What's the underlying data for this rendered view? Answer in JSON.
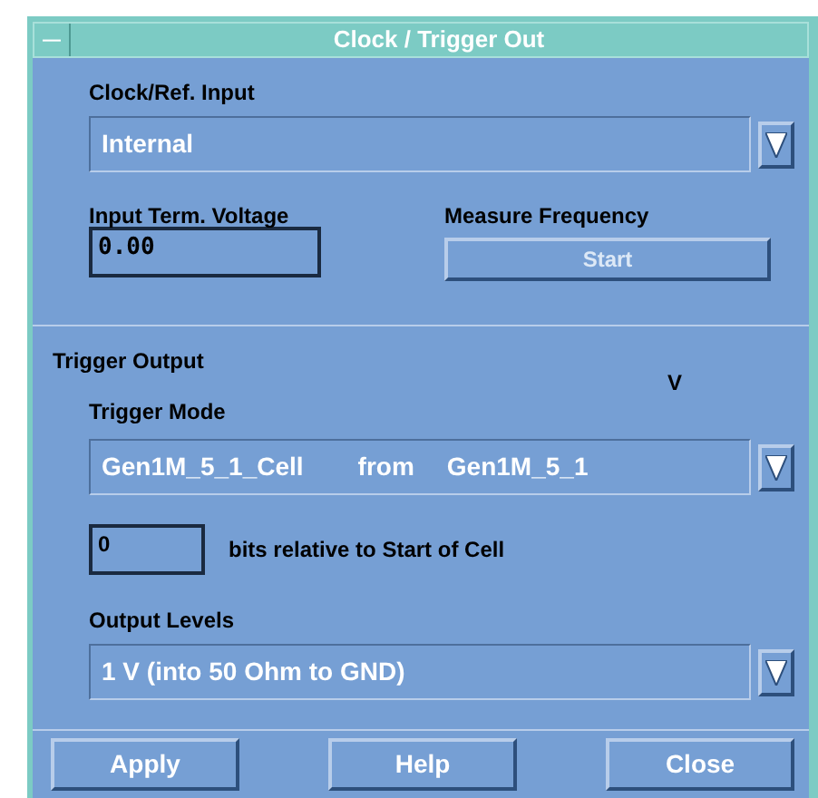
{
  "window": {
    "title": "Clock / Trigger Out",
    "menu_glyph": "—"
  },
  "clock_input": {
    "label": "Clock/Ref. Input",
    "value": "Internal"
  },
  "term_voltage": {
    "label": "Input Term. Voltage",
    "value": "0.00"
  },
  "measure_frequency": {
    "label": "Measure Frequency",
    "button": "Start",
    "disabled": true
  },
  "trigger_output": {
    "heading": "Trigger Output",
    "unit": "V",
    "mode": {
      "label": "Trigger Mode",
      "value": "Gen1M_5_1_Cell",
      "from": "from",
      "source": "Gen1M_5_1"
    },
    "offset": {
      "value": "0",
      "label": "bits relative to Start of Cell"
    },
    "levels": {
      "label": "Output Levels",
      "value": "1 V (into 50 Ohm to GND)"
    }
  },
  "buttons": [
    "Apply",
    "Help",
    "Close"
  ]
}
